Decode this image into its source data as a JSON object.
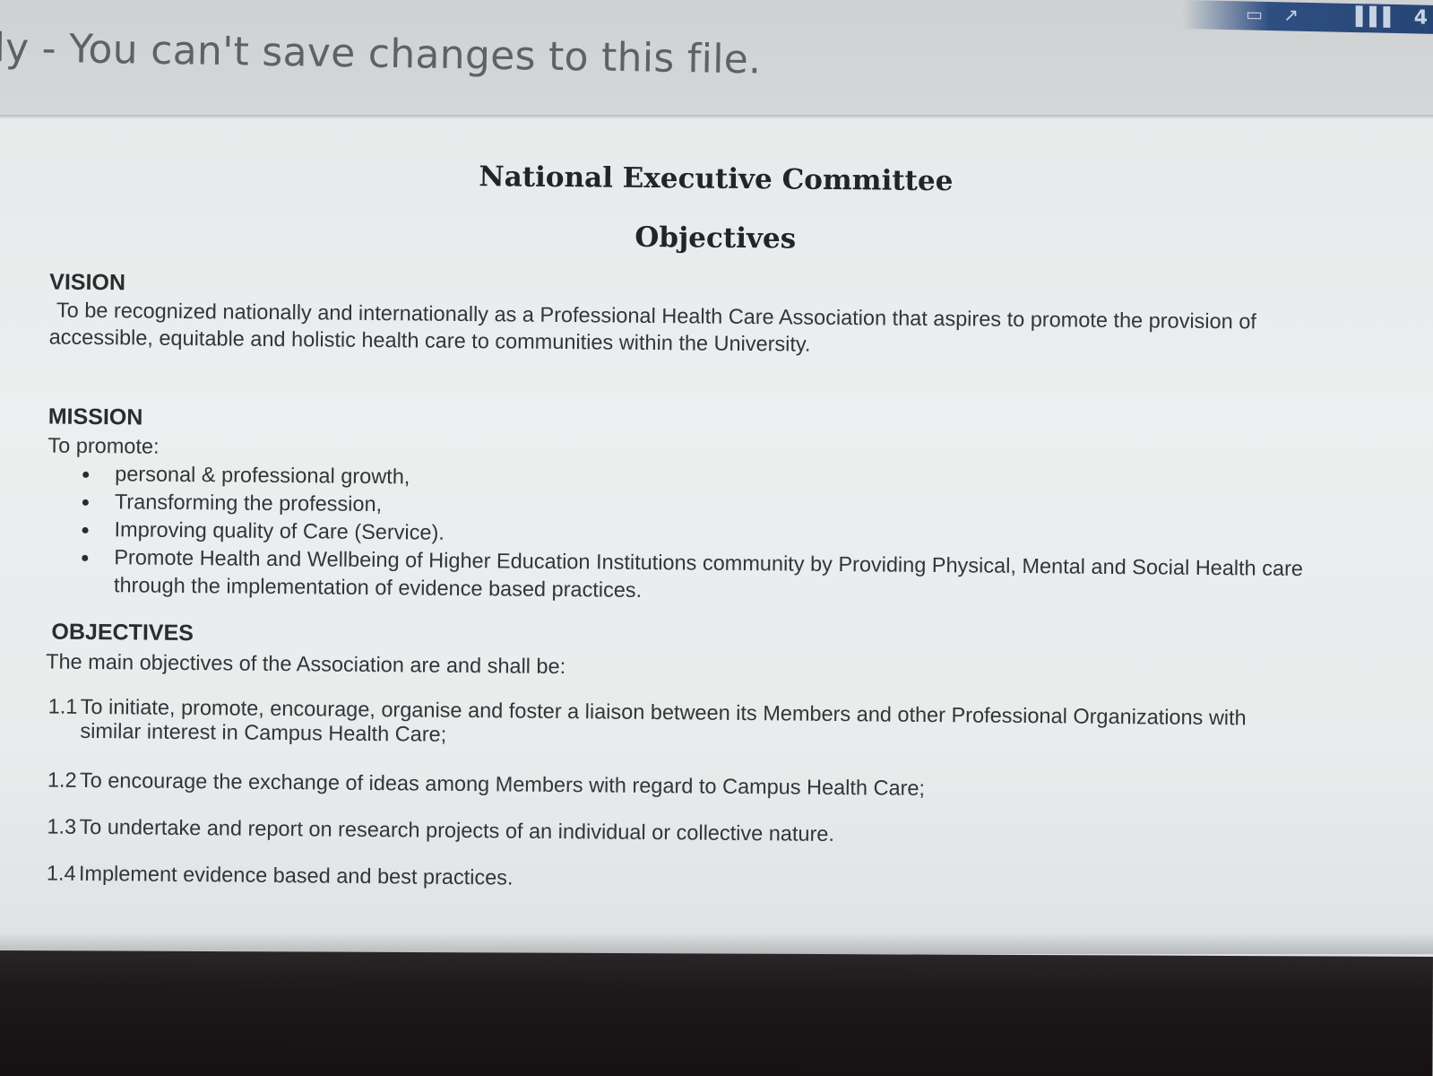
{
  "message_bar": {
    "text": "ly - You can't save changes to this file."
  },
  "system_tray": {
    "battery_icon": "battery-icon",
    "network_icon": "network-icon",
    "signal_icon": "signal-bars-icon",
    "count": "4"
  },
  "document": {
    "title": "National Executive Committee",
    "subtitle": "Objectives",
    "vision": {
      "heading": "VISION",
      "text": "To be recognized nationally and internationally as a Professional Health Care Association that aspires to promote the provision of accessible, equitable and holistic health care to communities within the University."
    },
    "mission": {
      "heading": "MISSION",
      "intro": "To promote:",
      "items": [
        "personal & professional growth,",
        "Transforming the profession,",
        "Improving quality of Care (Service).",
        "Promote Health and Wellbeing of Higher Education Institutions community by Providing Physical, Mental and Social Health care through the implementation of evidence based practices."
      ]
    },
    "objectives": {
      "heading": "OBJECTIVES",
      "intro": "The main objectives of the Association are and shall be:",
      "items": [
        {
          "number": "1.1",
          "text": "To initiate, promote, encourage, organise and foster a liaison between its Members and other Professional Organizations with",
          "continuation": "similar interest in Campus Health Care;"
        },
        {
          "number": "1.2",
          "text": "To encourage the exchange of ideas among Members with regard to Campus Health Care;"
        },
        {
          "number": "1.3",
          "text": "To undertake and report on research projects of an individual or collective nature."
        },
        {
          "number": "1.4",
          "text": "Implement evidence based and best practices."
        }
      ]
    }
  }
}
